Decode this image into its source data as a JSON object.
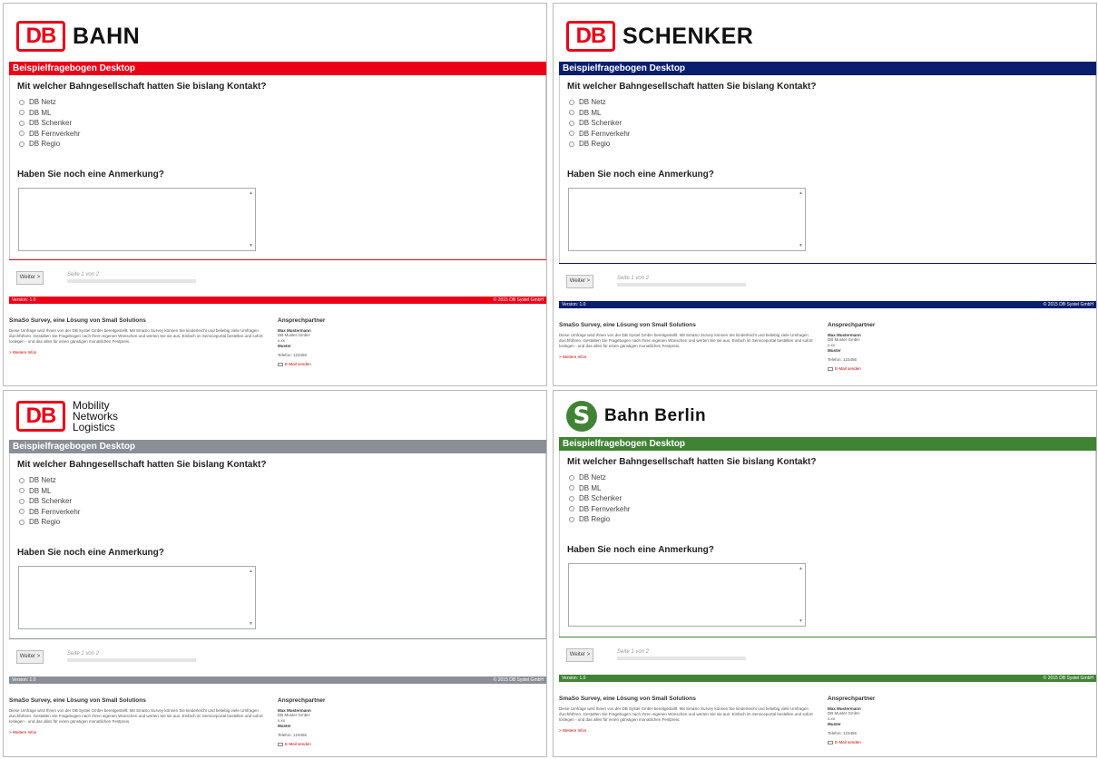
{
  "colors": {
    "bahn": "#ec0016",
    "schenker": "#0a1e6e",
    "mobility": "#8a8f96",
    "sbahn": "#408335",
    "db_red": "#ec0016"
  },
  "shared": {
    "question1": "Mit welcher Bahngesellschaft hatten Sie bislang Kontakt?",
    "options": [
      "DB Netz",
      "DB ML",
      "DB Schenker",
      "DB Fernverkehr",
      "DB Regio"
    ],
    "question2": "Haben Sie noch eine Anmerkung?",
    "next_label": "Weiter >",
    "page_text": "Seite 1 von 2",
    "version": "Version: 1.0",
    "copyright": "© 2015 DB Systel GmbH",
    "footer": {
      "title": "SmaSo Survey, eine Lösung von Small Solutions",
      "text": "Diese Umfrage wird Ihnen von der DB Systel GmbH bereitgestellt. Mit SmaSo Survey können Sie kinderleicht und beliebig viele Umfragen durchführen. Gestalten Sie Fragebogen nach Ihren eigenen Wünschen und werten Sie sie aus. Einfach im Serviceportal bestellen und sofort loslegen - und das alles für einen günstigen monatlichen Festpreis.",
      "link": "> Weitere Infos",
      "contact_title": "Ansprechpartner",
      "contact_name": "Max Mustermann",
      "contact_lines": [
        "DB Muster GmbH",
        "x.xx",
        "Muster"
      ],
      "phone": "Telefon: 123456",
      "email": "E-Mail senden"
    }
  },
  "panels": [
    {
      "brand": "bahn",
      "db_text": "DB",
      "logo_text": "BAHN",
      "title": "Beispielfragebogen Desktop",
      "icons": [
        "db-logo-icon"
      ]
    },
    {
      "brand": "schenker",
      "db_text": "DB",
      "logo_text": "SCHENKER",
      "title": "Beispielfragebogen Desktop",
      "icons": [
        "db-logo-icon"
      ]
    },
    {
      "brand": "mobility",
      "db_text": "DB",
      "logo_lines": [
        "Mobility",
        "Networks",
        "Logistics"
      ],
      "title": "Beispielfragebogen Desktop",
      "icons": [
        "db-logo-icon"
      ]
    },
    {
      "brand": "sbahn",
      "s_text": "S",
      "logo_text": "Bahn Berlin",
      "title": "Beispielfragebogen Desktop",
      "icons": [
        "s-bahn-logo-icon"
      ]
    }
  ]
}
